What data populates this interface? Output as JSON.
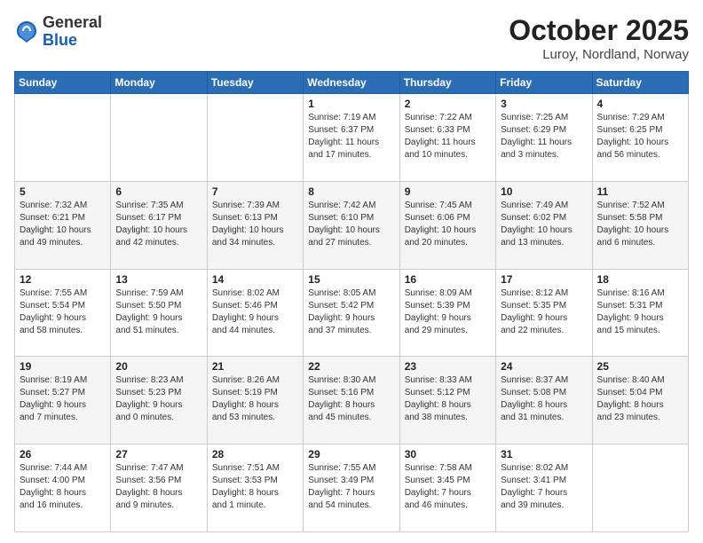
{
  "logo": {
    "general": "General",
    "blue": "Blue"
  },
  "title": {
    "month": "October 2025",
    "location": "Luroy, Nordland, Norway"
  },
  "days": [
    "Sunday",
    "Monday",
    "Tuesday",
    "Wednesday",
    "Thursday",
    "Friday",
    "Saturday"
  ],
  "weeks": [
    [
      {
        "date": "",
        "info": ""
      },
      {
        "date": "",
        "info": ""
      },
      {
        "date": "",
        "info": ""
      },
      {
        "date": "1",
        "info": "Sunrise: 7:19 AM\nSunset: 6:37 PM\nDaylight: 11 hours\nand 17 minutes."
      },
      {
        "date": "2",
        "info": "Sunrise: 7:22 AM\nSunset: 6:33 PM\nDaylight: 11 hours\nand 10 minutes."
      },
      {
        "date": "3",
        "info": "Sunrise: 7:25 AM\nSunset: 6:29 PM\nDaylight: 11 hours\nand 3 minutes."
      },
      {
        "date": "4",
        "info": "Sunrise: 7:29 AM\nSunset: 6:25 PM\nDaylight: 10 hours\nand 56 minutes."
      }
    ],
    [
      {
        "date": "5",
        "info": "Sunrise: 7:32 AM\nSunset: 6:21 PM\nDaylight: 10 hours\nand 49 minutes."
      },
      {
        "date": "6",
        "info": "Sunrise: 7:35 AM\nSunset: 6:17 PM\nDaylight: 10 hours\nand 42 minutes."
      },
      {
        "date": "7",
        "info": "Sunrise: 7:39 AM\nSunset: 6:13 PM\nDaylight: 10 hours\nand 34 minutes."
      },
      {
        "date": "8",
        "info": "Sunrise: 7:42 AM\nSunset: 6:10 PM\nDaylight: 10 hours\nand 27 minutes."
      },
      {
        "date": "9",
        "info": "Sunrise: 7:45 AM\nSunset: 6:06 PM\nDaylight: 10 hours\nand 20 minutes."
      },
      {
        "date": "10",
        "info": "Sunrise: 7:49 AM\nSunset: 6:02 PM\nDaylight: 10 hours\nand 13 minutes."
      },
      {
        "date": "11",
        "info": "Sunrise: 7:52 AM\nSunset: 5:58 PM\nDaylight: 10 hours\nand 6 minutes."
      }
    ],
    [
      {
        "date": "12",
        "info": "Sunrise: 7:55 AM\nSunset: 5:54 PM\nDaylight: 9 hours\nand 58 minutes."
      },
      {
        "date": "13",
        "info": "Sunrise: 7:59 AM\nSunset: 5:50 PM\nDaylight: 9 hours\nand 51 minutes."
      },
      {
        "date": "14",
        "info": "Sunrise: 8:02 AM\nSunset: 5:46 PM\nDaylight: 9 hours\nand 44 minutes."
      },
      {
        "date": "15",
        "info": "Sunrise: 8:05 AM\nSunset: 5:42 PM\nDaylight: 9 hours\nand 37 minutes."
      },
      {
        "date": "16",
        "info": "Sunrise: 8:09 AM\nSunset: 5:39 PM\nDaylight: 9 hours\nand 29 minutes."
      },
      {
        "date": "17",
        "info": "Sunrise: 8:12 AM\nSunset: 5:35 PM\nDaylight: 9 hours\nand 22 minutes."
      },
      {
        "date": "18",
        "info": "Sunrise: 8:16 AM\nSunset: 5:31 PM\nDaylight: 9 hours\nand 15 minutes."
      }
    ],
    [
      {
        "date": "19",
        "info": "Sunrise: 8:19 AM\nSunset: 5:27 PM\nDaylight: 9 hours\nand 7 minutes."
      },
      {
        "date": "20",
        "info": "Sunrise: 8:23 AM\nSunset: 5:23 PM\nDaylight: 9 hours\nand 0 minutes."
      },
      {
        "date": "21",
        "info": "Sunrise: 8:26 AM\nSunset: 5:19 PM\nDaylight: 8 hours\nand 53 minutes."
      },
      {
        "date": "22",
        "info": "Sunrise: 8:30 AM\nSunset: 5:16 PM\nDaylight: 8 hours\nand 45 minutes."
      },
      {
        "date": "23",
        "info": "Sunrise: 8:33 AM\nSunset: 5:12 PM\nDaylight: 8 hours\nand 38 minutes."
      },
      {
        "date": "24",
        "info": "Sunrise: 8:37 AM\nSunset: 5:08 PM\nDaylight: 8 hours\nand 31 minutes."
      },
      {
        "date": "25",
        "info": "Sunrise: 8:40 AM\nSunset: 5:04 PM\nDaylight: 8 hours\nand 23 minutes."
      }
    ],
    [
      {
        "date": "26",
        "info": "Sunrise: 7:44 AM\nSunset: 4:00 PM\nDaylight: 8 hours\nand 16 minutes."
      },
      {
        "date": "27",
        "info": "Sunrise: 7:47 AM\nSunset: 3:56 PM\nDaylight: 8 hours\nand 9 minutes."
      },
      {
        "date": "28",
        "info": "Sunrise: 7:51 AM\nSunset: 3:53 PM\nDaylight: 8 hours\nand 1 minute."
      },
      {
        "date": "29",
        "info": "Sunrise: 7:55 AM\nSunset: 3:49 PM\nDaylight: 7 hours\nand 54 minutes."
      },
      {
        "date": "30",
        "info": "Sunrise: 7:58 AM\nSunset: 3:45 PM\nDaylight: 7 hours\nand 46 minutes."
      },
      {
        "date": "31",
        "info": "Sunrise: 8:02 AM\nSunset: 3:41 PM\nDaylight: 7 hours\nand 39 minutes."
      },
      {
        "date": "",
        "info": ""
      }
    ]
  ]
}
